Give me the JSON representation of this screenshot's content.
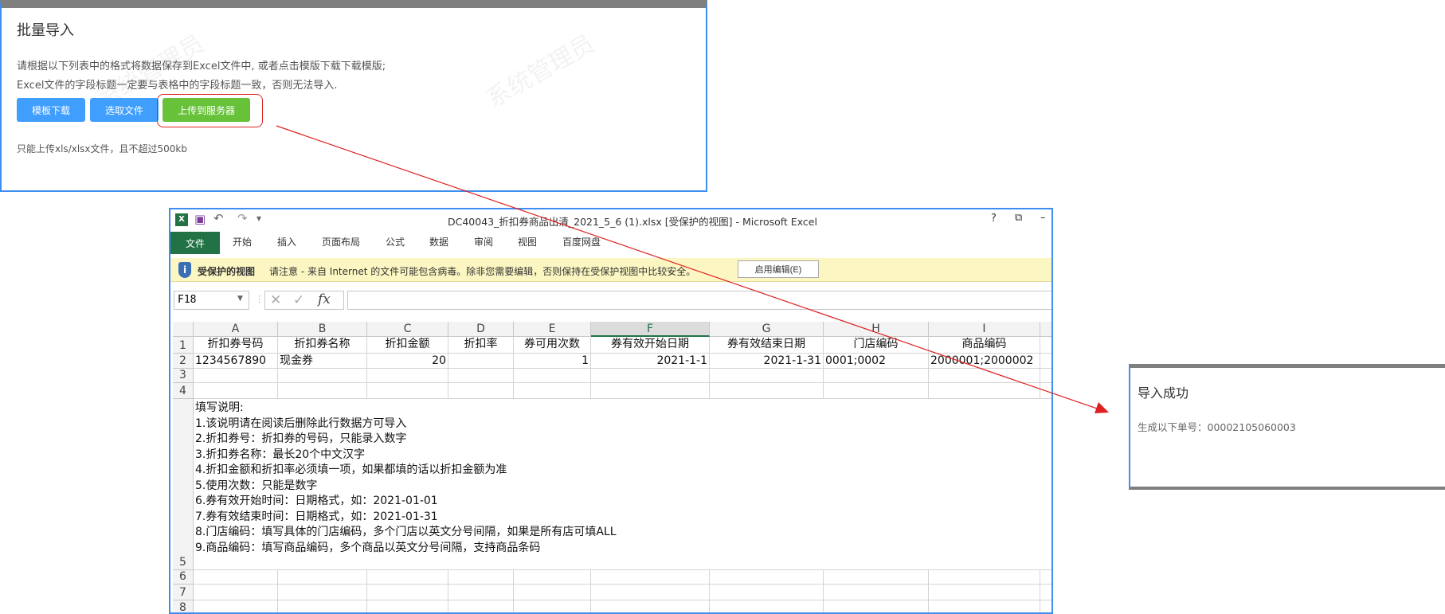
{
  "import_dialog": {
    "title": "批量导入",
    "instruction_line1": "请根据以下列表中的格式将数据保存到Excel文件中, 或者点击模版下载下载模版;",
    "instruction_line2": "Excel文件的字段标题一定要与表格中的字段标题一致，否则无法导入.",
    "buttons": {
      "template_download": "模板下载",
      "select_file": "选取文件",
      "upload": "上传到服务器"
    },
    "hint": "只能上传xls/xlsx文件，且不超过500kb",
    "watermark": "系统管理员",
    "colors": {
      "primary": "#409eff",
      "success": "#67c23a",
      "highlight": "#e02020"
    }
  },
  "excel": {
    "window_title": "DC40043_折扣券商品出清_2021_5_6 (1).xlsx  [受保护的视图] - Microsoft Excel",
    "window_controls": {
      "help": "?",
      "restore": "⧉",
      "minimize": "–"
    },
    "ribbon_tabs": [
      "文件",
      "开始",
      "插入",
      "页面布局",
      "公式",
      "数据",
      "审阅",
      "视图",
      "百度网盘"
    ],
    "protected_view": {
      "label": "受保护的视图",
      "message": "请注意 - 来自 Internet 的文件可能包含病毒。除非您需要编辑，否则保持在受保护视图中比较安全。",
      "enable_button": "启用编辑(E)"
    },
    "name_box": "F18",
    "formula_value": "",
    "columns": [
      "A",
      "B",
      "C",
      "D",
      "E",
      "F",
      "G",
      "H",
      "I"
    ],
    "selected_column": "F",
    "row_numbers": [
      "1",
      "2",
      "3",
      "4",
      "5",
      "6",
      "7",
      "8"
    ],
    "header_row": [
      "折扣券号码",
      "折扣券名称",
      "折扣金额",
      "折扣率",
      "券可用次数",
      "券有效开始日期",
      "券有效结束日期",
      "门店编码",
      "商品编码"
    ],
    "data_row": [
      "1234567890",
      "现金券",
      "20",
      "",
      "1",
      "2021-1-1",
      "2021-1-31",
      "0001;0002",
      "2000001;2000002"
    ],
    "notes": [
      "填写说明:",
      "1.该说明请在阅读后删除此行数据方可导入",
      "2.折扣券号：折扣券的号码，只能录入数字",
      "3.折扣券名称：最长20个中文汉字",
      "4.折扣金额和折扣率必须填一项，如果都填的话以折扣金额为准",
      "5.使用次数：只能是数字",
      "6.券有效开始时间：日期格式，如：2021-01-01",
      "7.券有效结束时间：日期格式，如：2021-01-31",
      "8.门店编码：填写具体的门店编码，多个门店以英文分号间隔，如果是所有店可填ALL",
      "9.商品编码：填写商品编码，多个商品以英文分号间隔，支持商品条码"
    ]
  },
  "success_dialog": {
    "title": "导入成功",
    "message": "生成以下单号：00002105060003"
  }
}
